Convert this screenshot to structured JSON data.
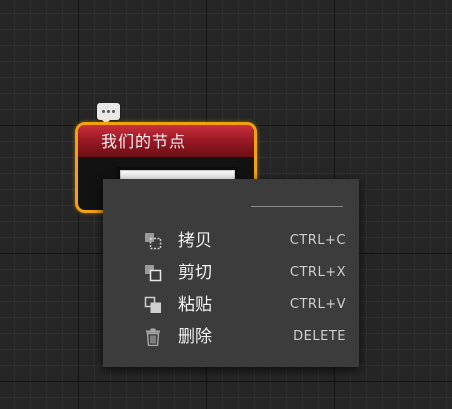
{
  "node": {
    "title": "我们的节点"
  },
  "rename": {
    "value": "我们的节点"
  },
  "context_menu": {
    "items": [
      {
        "label": "拷贝",
        "shortcut": "CTRL+C",
        "icon": "copy-icon"
      },
      {
        "label": "剪切",
        "shortcut": "CTRL+X",
        "icon": "cut-icon"
      },
      {
        "label": "粘贴",
        "shortcut": "CTRL+V",
        "icon": "paste-icon"
      },
      {
        "label": "删除",
        "shortcut": "DELETE",
        "icon": "trash-icon"
      }
    ]
  },
  "colors": {
    "background": "#262626",
    "node_border": "#f0a30a",
    "node_header": "#9c1a26",
    "menu_background": "#3c3c3c"
  }
}
